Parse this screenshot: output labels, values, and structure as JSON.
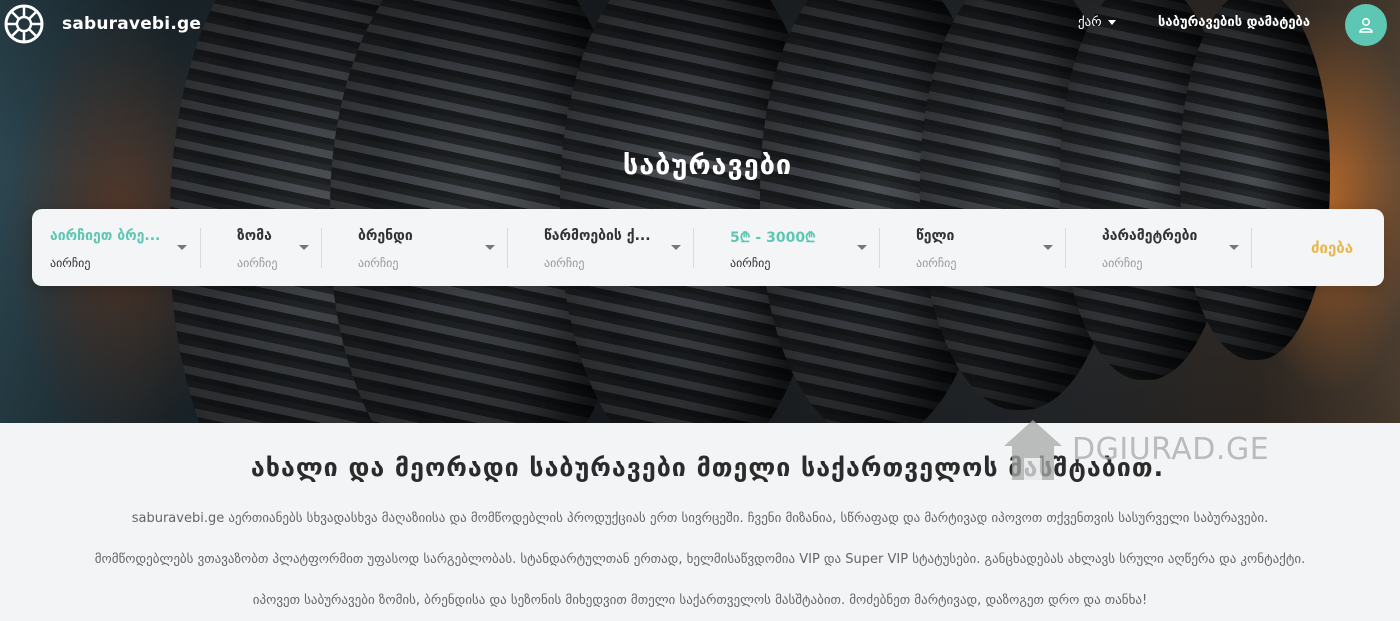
{
  "header": {
    "logo_text": "saburavebi.ge",
    "language": "ქარ",
    "add_tires_link": "საბურავების დამატება"
  },
  "hero": {
    "title": "საბურავები"
  },
  "filters": {
    "items": [
      {
        "label": "აირჩიეთ ბრე...",
        "value": "აირჩიე"
      },
      {
        "label": "ზომა",
        "value": "აირჩიე"
      },
      {
        "label": "ბრენდი",
        "value": "აირჩიე"
      },
      {
        "label": "წარმოების ქ...",
        "value": "აირჩიე"
      },
      {
        "label": "5₾ - 3000₾",
        "value": "აირჩიე"
      },
      {
        "label": "წელი",
        "value": "აირჩიე"
      },
      {
        "label": "პარამეტრები",
        "value": "აირჩიე"
      }
    ],
    "search_label": "ძიება"
  },
  "content": {
    "title": "ახალი და მეორადი საბურავები მთელი საქართველოს მასშტაბით.",
    "paragraphs": [
      "saburavebi.ge აერთიანებს სხვადასხვა მაღაზიისა და მომწოდებლის პროდუქციას ერთ სივრცეში. ჩვენი მიზანია, სწრაფად და მარტივად იპოვოთ თქვენთვის სასურველი საბურავები.",
      "მომწოდებლებს ვთავაზობთ პლატფორმით უფასოდ სარგებლობას. სტანდარტულთან ერთად, ხელმისაწვდომია VIP და Super VIP სტატუსები. განცხადებას ახლავს სრული აღწერა და კონტაქტი.",
      "იპოვეთ საბურავები ზომის, ბრენდისა და სეზონის მიხედვით მთელი საქართველოს მასშტაბით. მოძებნეთ მარტივად, დაზოგეთ დრო და თანხა!"
    ]
  },
  "watermark": {
    "text": "DGIURAD.GE"
  },
  "colors": {
    "accent_teal": "#5ec7b3",
    "search_yellow": "#e8b84a"
  },
  "icons": {
    "logo": "tire-logo-icon",
    "avatar": "user-icon",
    "dropdown": "caret-down-icon"
  }
}
